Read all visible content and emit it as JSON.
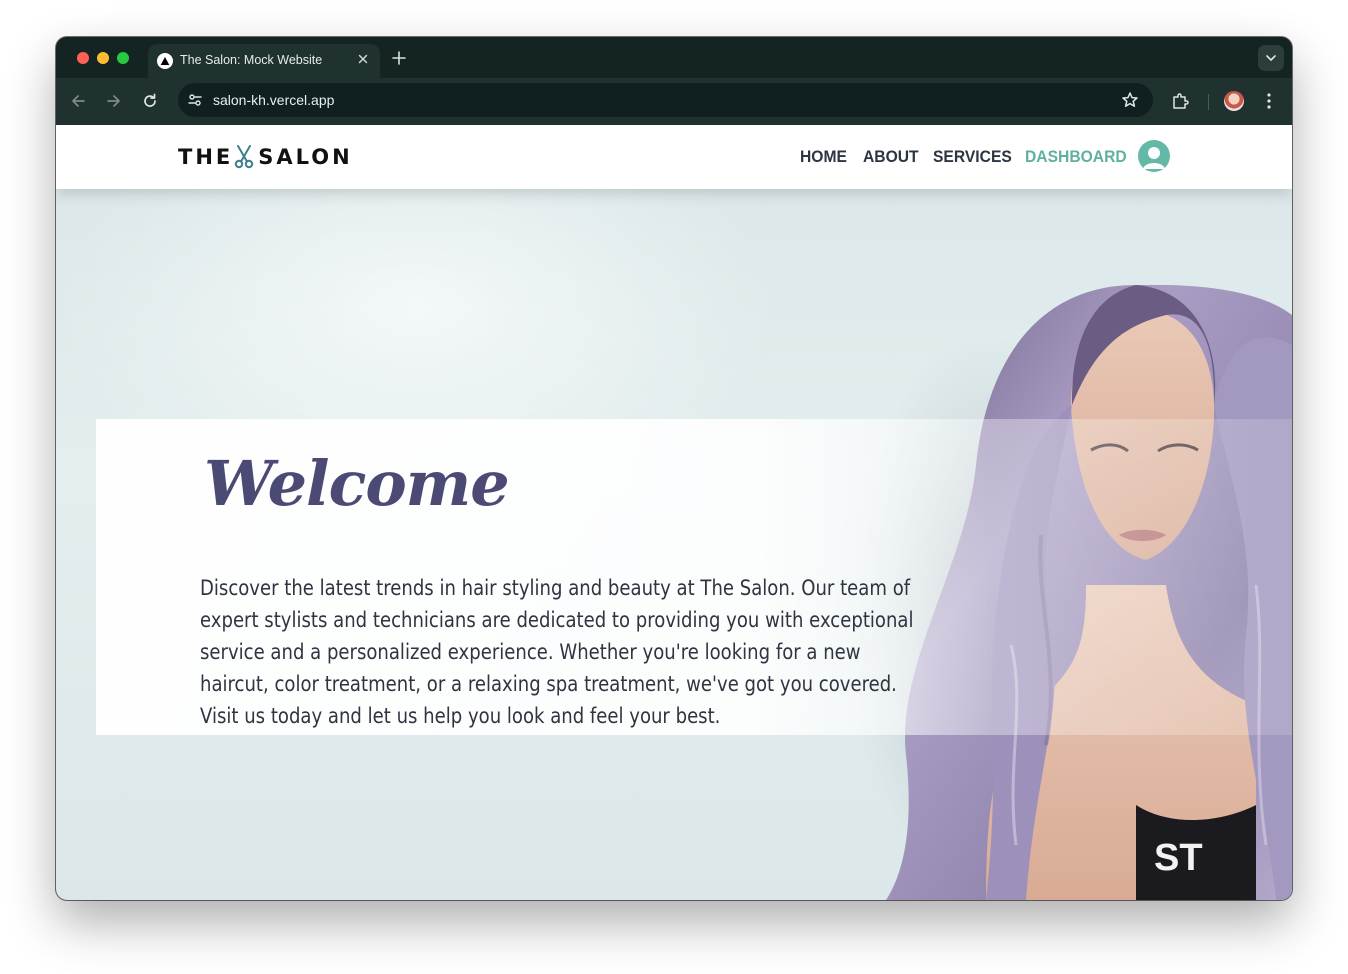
{
  "browser": {
    "tab": {
      "title": "The Salon: Mock Website",
      "favicon_icon": "vercel-triangle-icon"
    },
    "address_bar": {
      "url": "salon-kh.vercel.app"
    },
    "theme_colors": {
      "tabstrip": "#142423",
      "toolbar": "#1f3230",
      "omnibox": "#102020"
    }
  },
  "site": {
    "logo": {
      "left_text": "THE",
      "right_text": "SALON",
      "icon": "scissors-icon"
    },
    "nav": {
      "items": [
        {
          "label": "HOME"
        },
        {
          "label": "ABOUT"
        },
        {
          "label": "SERVICES"
        },
        {
          "label": "DASHBOARD",
          "active": true
        }
      ],
      "user_icon": "user-avatar-icon"
    },
    "hero": {
      "heading": "Welcome",
      "body": "Discover the latest trends in hair styling and beauty at The Salon. Our team of expert stylists and technicians are dedicated to providing you with exceptional service and a personalized experience. Whether you're looking for a new haircut, color treatment, or a relaxing spa treatment, we've got you covered. Visit us today and let us help you look and feel your best.",
      "shirt_text": "ST"
    },
    "colors": {
      "accent": "#5fb0a0",
      "heading": "#4b4a75",
      "nav_text": "#2c3541",
      "hair": "#9a8db8"
    }
  }
}
